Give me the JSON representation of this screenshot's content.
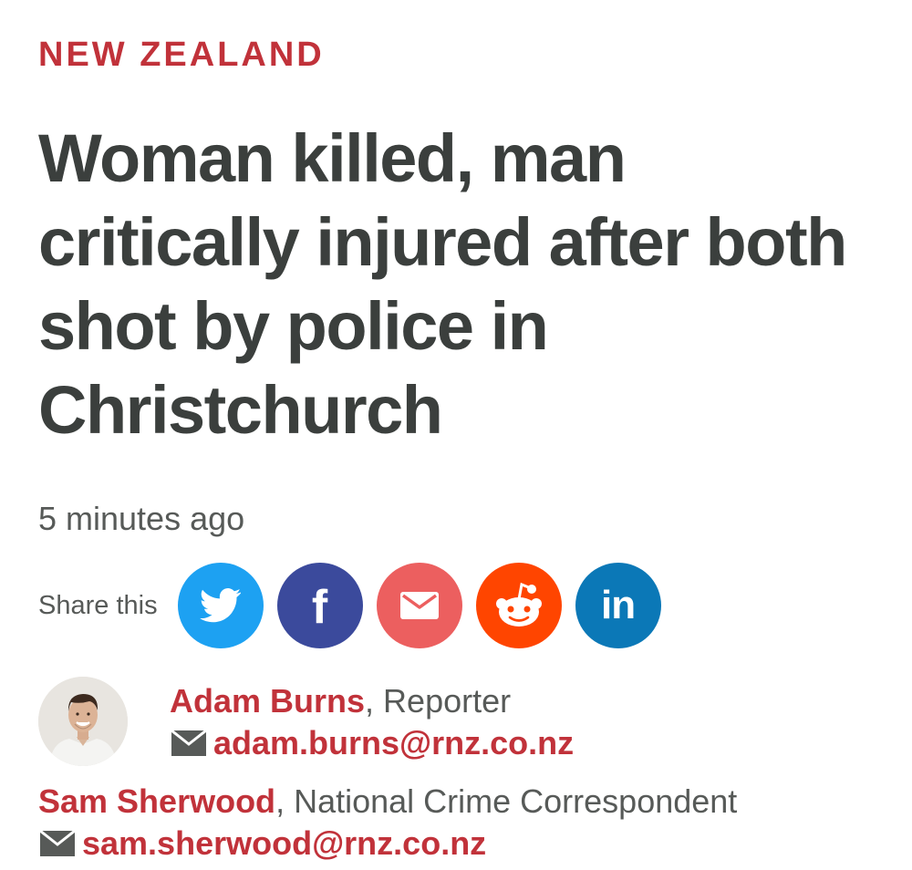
{
  "article": {
    "section": "NEW ZEALAND",
    "headline": "Woman killed, man critically injured after both shot by police in Christchurch",
    "timestamp": "5 minutes ago"
  },
  "share": {
    "label": "Share this",
    "buttons": [
      {
        "name": "twitter",
        "icon": "twitter-bird-icon",
        "color": "#1da1f2"
      },
      {
        "name": "facebook",
        "icon": "facebook-f-icon",
        "color": "#3b4a9c"
      },
      {
        "name": "email",
        "icon": "envelope-icon",
        "color": "#ec5f5f"
      },
      {
        "name": "reddit",
        "icon": "reddit-alien-icon",
        "color": "#ff4500"
      },
      {
        "name": "linkedin",
        "icon": "linkedin-in-icon",
        "color": "#0b78b7"
      }
    ],
    "facebook_glyph": "f",
    "linkedin_glyph": "in"
  },
  "authors": [
    {
      "name": "Adam Burns",
      "separator": ", ",
      "role": "Reporter",
      "email": "adam.burns@rnz.co.nz",
      "has_avatar": true
    },
    {
      "name": "Sam Sherwood",
      "separator": ", ",
      "role": "National Crime Correspondent",
      "email": "sam.sherwood@rnz.co.nz",
      "has_avatar": false
    }
  ],
  "colors": {
    "accent": "#c1323a",
    "text": "#3b3f3d",
    "muted": "#575a58"
  }
}
